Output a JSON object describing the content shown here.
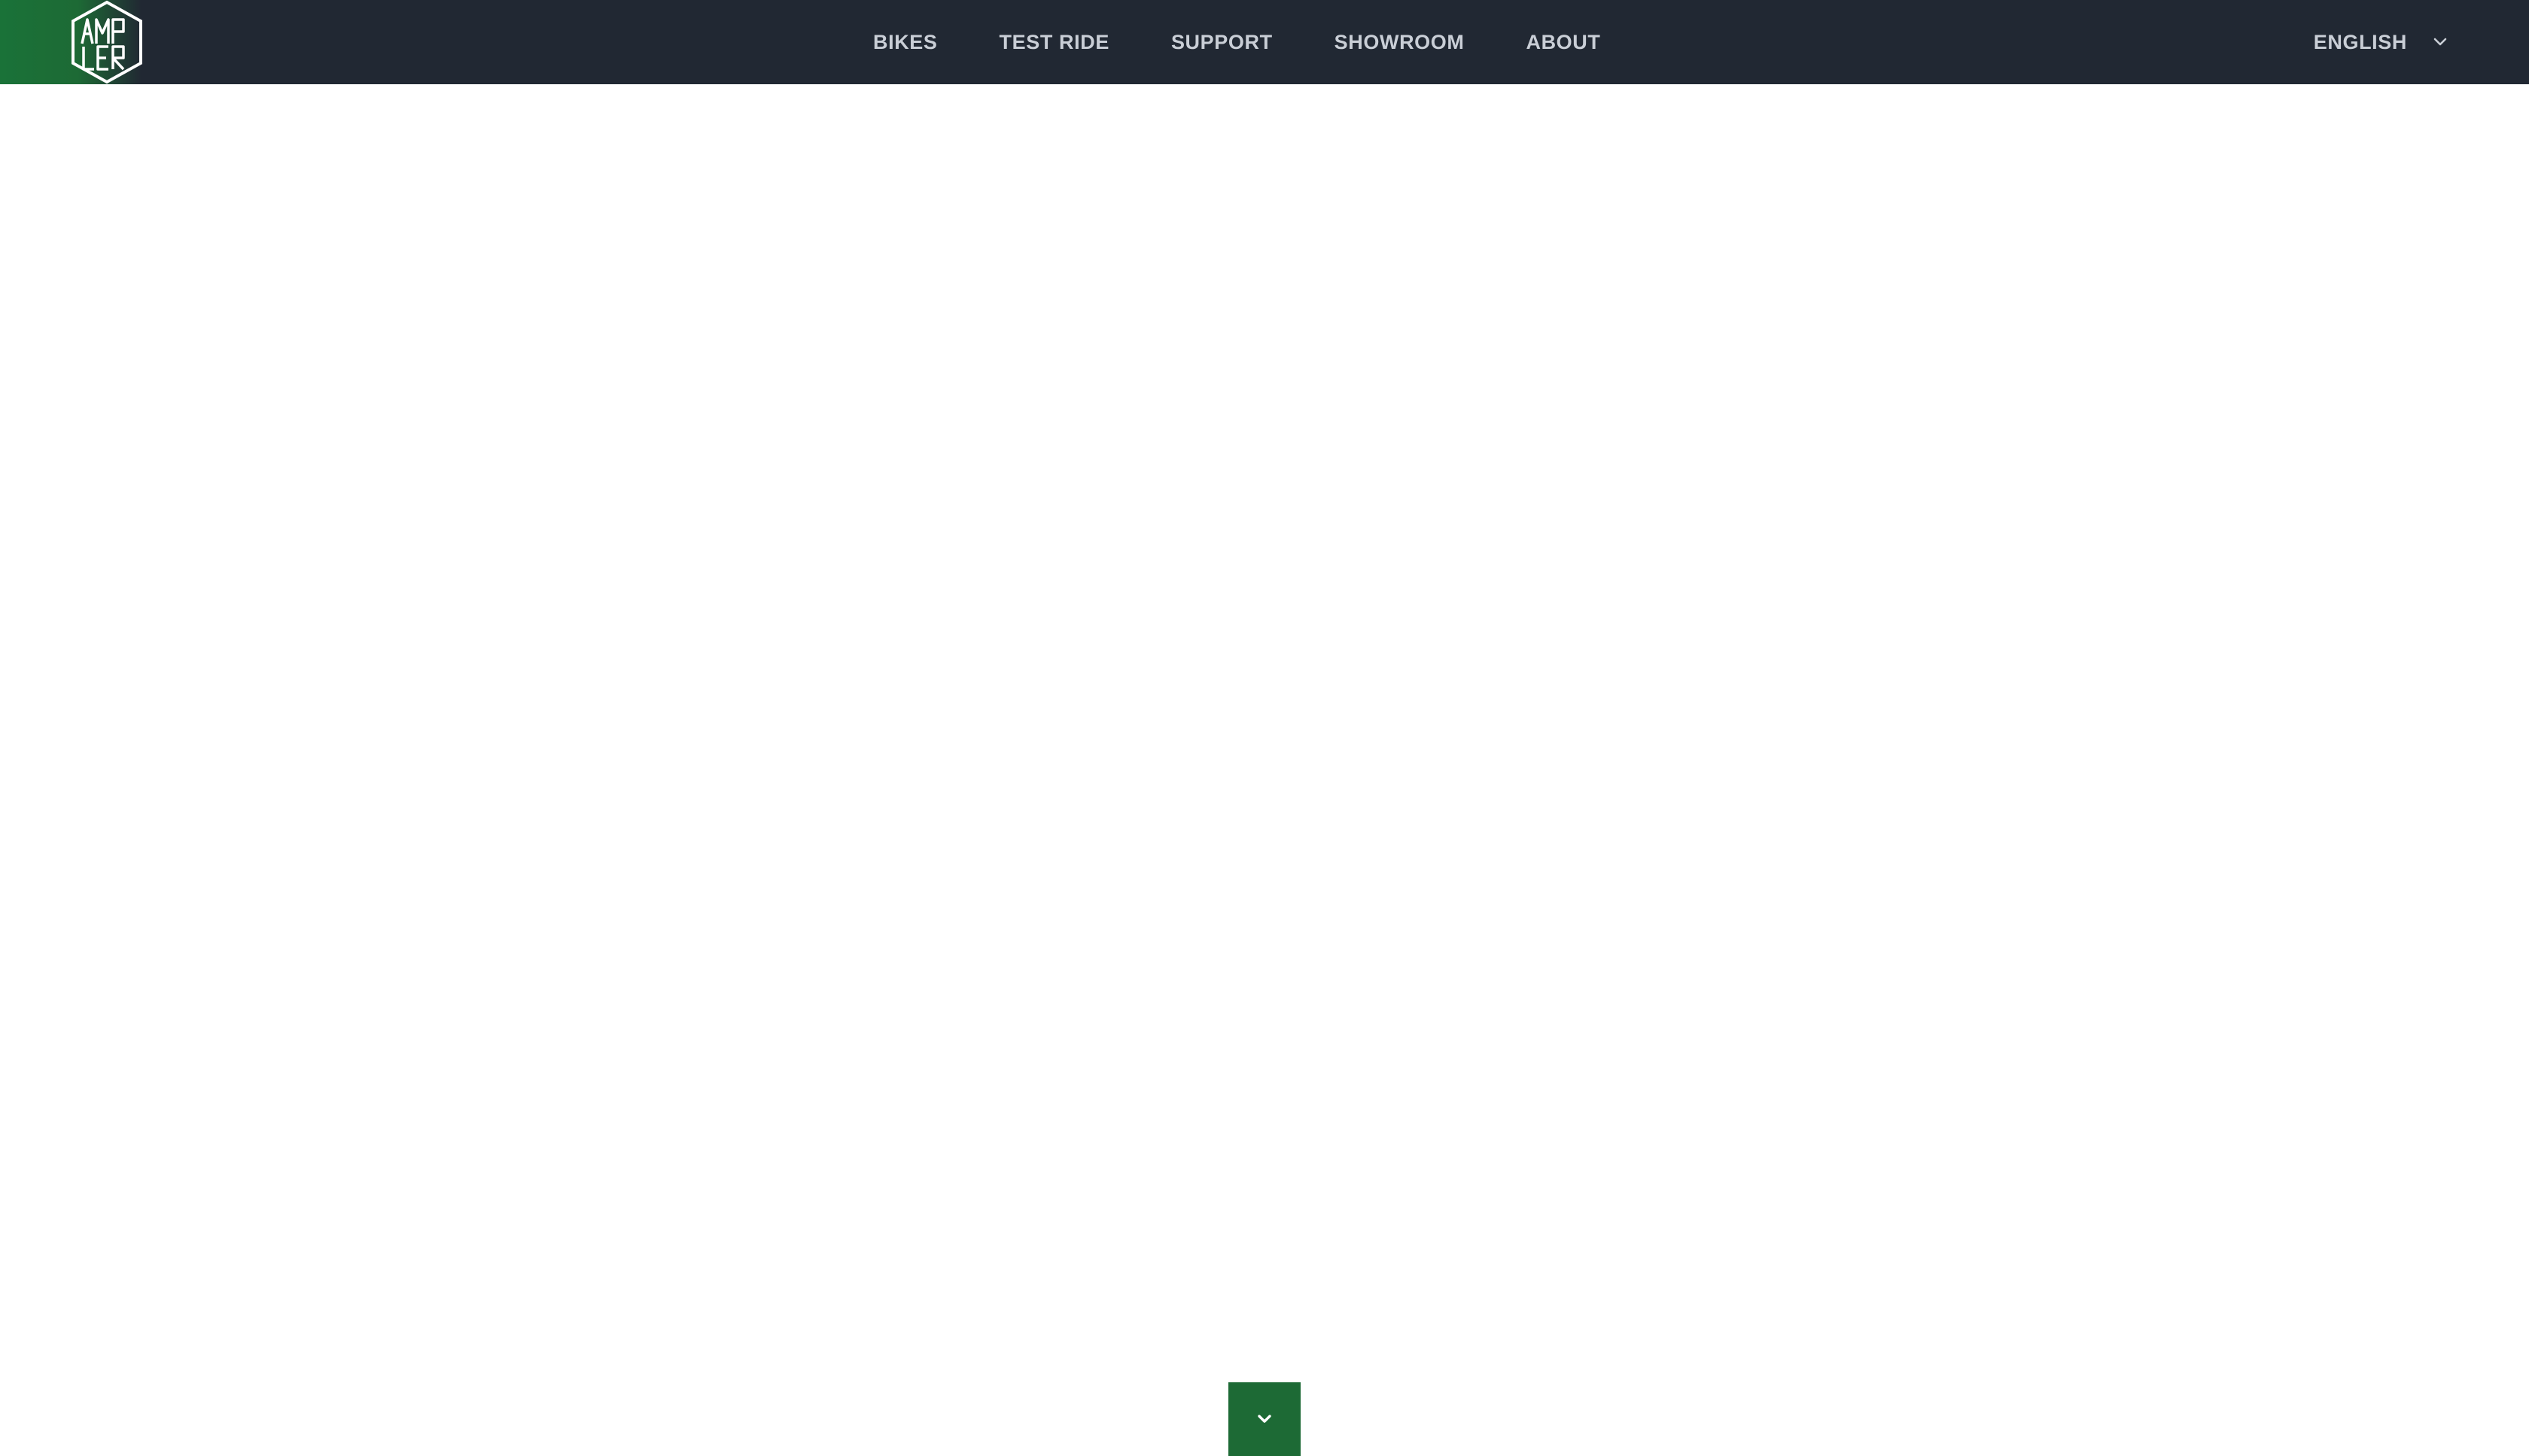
{
  "brand": {
    "logo_icon": "ampler-hexagon-logo",
    "logo_text": "AMPLER",
    "accent_color": "#1d6a35",
    "header_color": "#212833"
  },
  "nav": {
    "items": [
      {
        "label": "BIKES"
      },
      {
        "label": "TEST RIDE"
      },
      {
        "label": "SUPPORT"
      },
      {
        "label": "SHOWROOM"
      },
      {
        "label": "ABOUT"
      }
    ]
  },
  "language": {
    "label": "ENGLISH",
    "icon": "chevron-down-icon"
  },
  "scroll_button": {
    "icon": "chevron-down-icon"
  }
}
